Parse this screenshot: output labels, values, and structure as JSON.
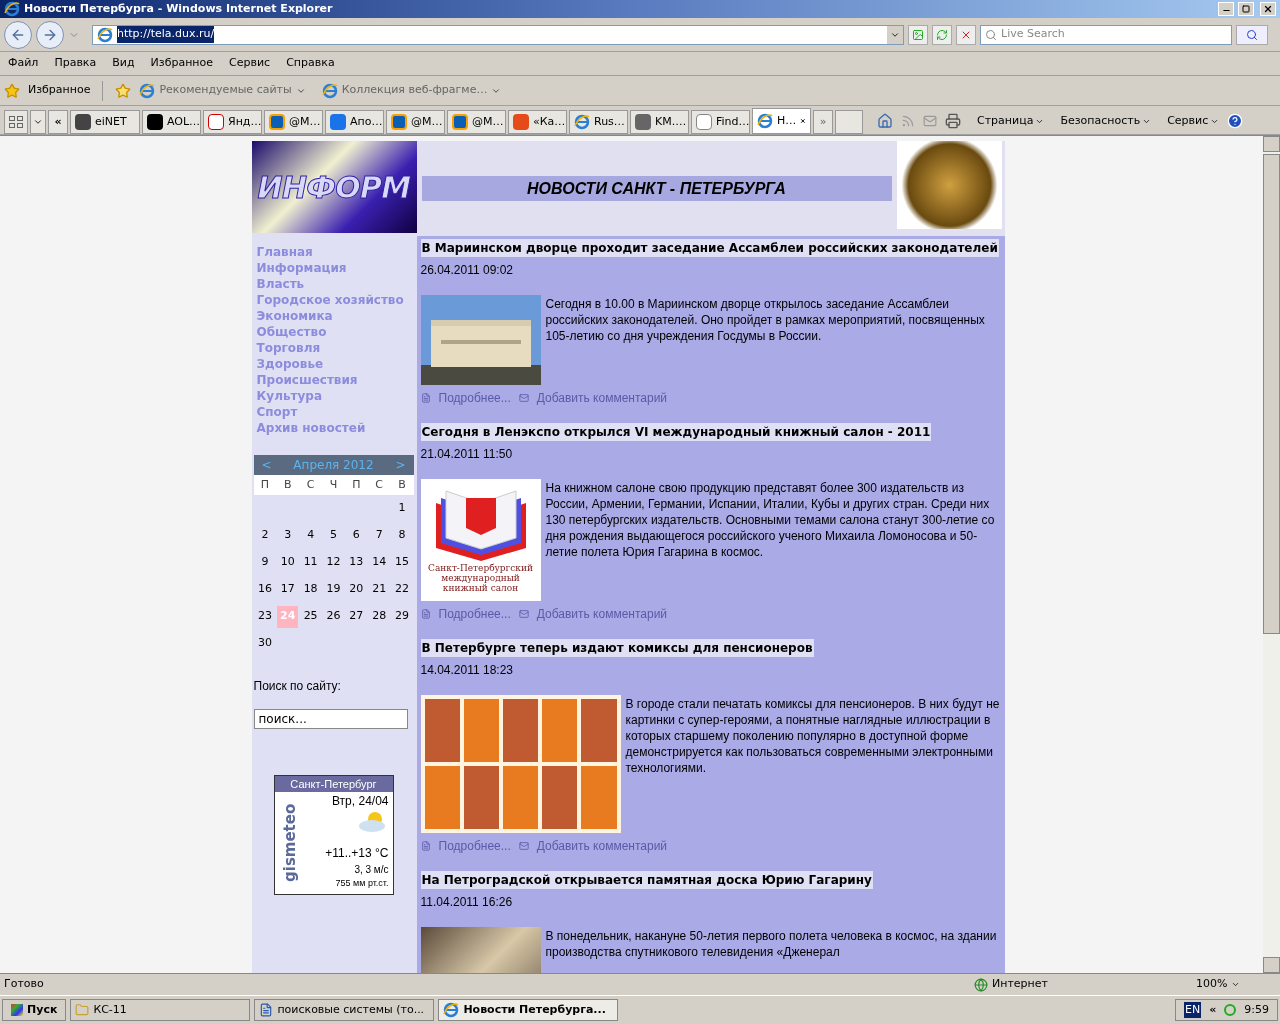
{
  "window": {
    "title": "Новости Петербурга - Windows Internet Explorer"
  },
  "address": {
    "value": "http://tela.dux.ru/"
  },
  "search": {
    "placeholder": "Live Search"
  },
  "menu": [
    "Файл",
    "Правка",
    "Вид",
    "Избранное",
    "Сервис",
    "Справка"
  ],
  "favorites_bar": {
    "label": "Избранное",
    "links": [
      "Рекомендуемые сайты",
      "Коллекция веб-фрагме…"
    ]
  },
  "tabs": [
    {
      "label": "eiNET",
      "kind": "ei",
      "selected": false
    },
    {
      "label": "AOL…",
      "kind": "aol",
      "selected": false
    },
    {
      "label": "Янд…",
      "kind": "yandex",
      "selected": false
    },
    {
      "label": "@M…",
      "kind": "mail",
      "selected": false
    },
    {
      "label": "Апо…",
      "kind": "a",
      "selected": false
    },
    {
      "label": "@M…",
      "kind": "mail",
      "selected": false
    },
    {
      "label": "@M…",
      "kind": "mail",
      "selected": false
    },
    {
      "label": "«Ка…",
      "kind": "rf",
      "selected": false
    },
    {
      "label": "Rus…",
      "kind": "ie",
      "selected": false
    },
    {
      "label": "KM.…",
      "kind": "km",
      "selected": false
    },
    {
      "label": "Find…",
      "kind": "fb",
      "selected": false
    },
    {
      "label": "Н…",
      "kind": "ie",
      "selected": true
    }
  ],
  "tab_scroll": {
    "left": "«",
    "right": "»"
  },
  "command_bar": [
    "Страница",
    "Безопасность",
    "Сервис"
  ],
  "page": {
    "logo": "ИНФОРМ",
    "title": "НОВОСТИ САНКТ - ПЕТЕРБУРГА",
    "nav": [
      "Главная",
      "Информация",
      "Власть",
      "Городское хозяйство",
      "Экономика",
      "Общество",
      "Торговля",
      "Здоровье",
      "Происшествия",
      "Культура",
      "Спорт",
      "Архив новостей"
    ],
    "calendar": {
      "prev": "<",
      "month": "Апреля 2012",
      "next": ">",
      "weekdays": [
        "П",
        "В",
        "С",
        "Ч",
        "П",
        "С",
        "В"
      ],
      "days": [
        {
          "label": "1",
          "selected": false
        },
        {
          "label": "2",
          "selected": false
        },
        {
          "label": "3",
          "selected": false
        },
        {
          "label": "4",
          "selected": false
        },
        {
          "label": "5",
          "selected": false
        },
        {
          "label": "6",
          "selected": false
        },
        {
          "label": "7",
          "selected": false
        },
        {
          "label": "8",
          "selected": false
        },
        {
          "label": "9",
          "selected": false
        },
        {
          "label": "10",
          "selected": false
        },
        {
          "label": "11",
          "selected": false
        },
        {
          "label": "12",
          "selected": false
        },
        {
          "label": "13",
          "selected": false
        },
        {
          "label": "14",
          "selected": false
        },
        {
          "label": "15",
          "selected": false
        },
        {
          "label": "16",
          "selected": false
        },
        {
          "label": "17",
          "selected": false
        },
        {
          "label": "18",
          "selected": false
        },
        {
          "label": "19",
          "selected": false
        },
        {
          "label": "20",
          "selected": false
        },
        {
          "label": "21",
          "selected": false
        },
        {
          "label": "22",
          "selected": false
        },
        {
          "label": "23",
          "selected": false
        },
        {
          "label": "24",
          "selected": true
        },
        {
          "label": "25",
          "selected": false
        },
        {
          "label": "26",
          "selected": false
        },
        {
          "label": "27",
          "selected": false
        },
        {
          "label": "28",
          "selected": false
        },
        {
          "label": "29",
          "selected": false
        },
        {
          "label": "30",
          "selected": false
        }
      ]
    },
    "site_search": {
      "label": "Поиск по сайту:",
      "placeholder": "поиск..."
    },
    "weather": {
      "city": "Санкт-Петербург",
      "brand": "gismeteo",
      "date": "Втр, 24/04",
      "temp": "+11..+13 °C",
      "wind": "3, 3 м/с",
      "pressure": "755 мм рт.ст."
    },
    "articles": [
      {
        "title": "В Мариинском дворце проходит заседание Ассамблеи российских законодателей",
        "date": "26.04.2011 09:02",
        "kind": "building",
        "body": "Сегодня в 10.00 в Мариинском дворце открылось заседание Ассамблеи российских законодателей. Оно пройдет в рамках мероприятий, посвященных 105-летию со дня учреждения Госдумы в России.",
        "more": "Подробнее...",
        "comment": "Добавить комментарий"
      },
      {
        "title": "Сегодня в Ленэкспо открылся VI международный книжный салон - 2011",
        "date": "21.04.2011 11:50",
        "kind": "salon",
        "caption": "Санкт-Петербургский международный книжный салон",
        "body": "На книжном салоне свою продукцию представят более 300 издательств из России, Армении, Германии, Испании, Италии, Кубы и других стран. Среди них 130 петербургских издательств. Основными темами салона станут 300-летие со дня рождения выдающегося российского ученого Михаила Ломоносова и 50-летие полета Юрия Гагарина в космос.",
        "more": "Подробнее...",
        "comment": "Добавить комментарий"
      },
      {
        "title": "В Петербурге теперь издают комиксы для пенсионеров",
        "date": "14.04.2011 18:23",
        "kind": "comic",
        "body": "В городе стали печатать комиксы для пенсионеров. В них будут не картинки с супер-героями, а понятные наглядные иллюстрации в которых старшему поколению популярно в доступной форме демонстрируется как пользоваться современными электронными технологиями.",
        "more": "Подробнее...",
        "comment": "Добавить комментарий"
      },
      {
        "title": "На Петроградской открывается памятная доска Юрию Гагарину",
        "date": "11.04.2011 16:26",
        "kind": "helmet",
        "body": "В понедельник, накануне 50-летия первого полета человека в космос, на здании производства спутникового телевидения «Дженерал"
      }
    ]
  },
  "status_bar": {
    "text": "Готово",
    "zone": "Интернет",
    "zoom": "100%"
  },
  "taskbar": {
    "start": "Пуск",
    "buttons": [
      {
        "label": "КС-11",
        "kind": "folder",
        "selected": false
      },
      {
        "label": "поисковые системы (то...",
        "kind": "word",
        "selected": false
      },
      {
        "label": "Новости Петербурга...",
        "kind": "ie",
        "selected": true
      }
    ],
    "lang": "EN",
    "tray": "«",
    "time": "9:59"
  }
}
